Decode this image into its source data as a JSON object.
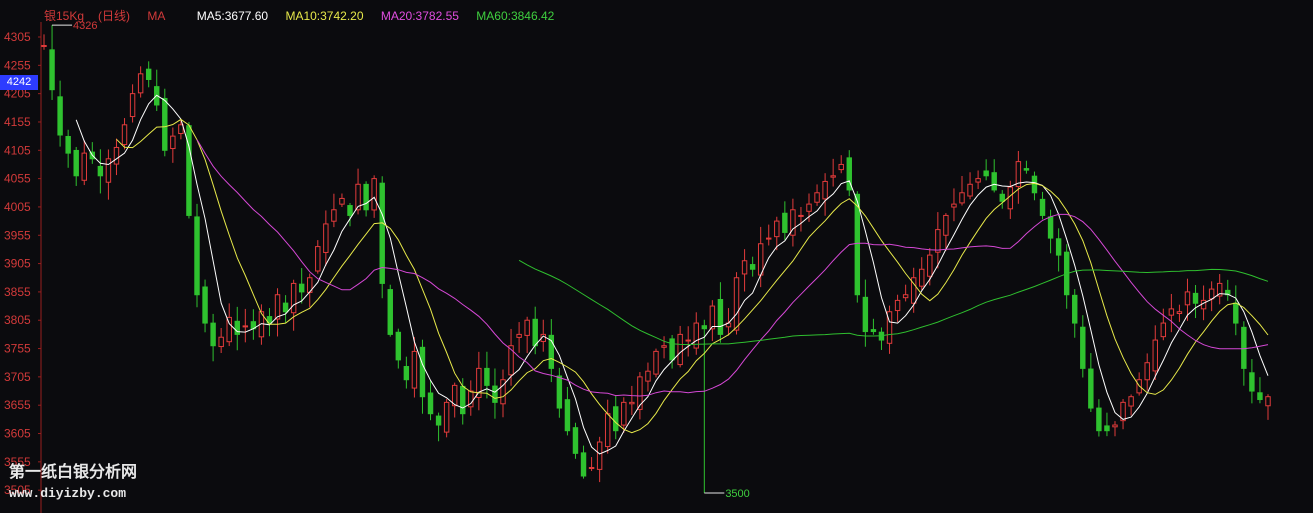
{
  "legend": {
    "title": "银15Kg",
    "period": "(日线)",
    "ma_label": "MA",
    "ma5": "MA5:3677.60",
    "ma10": "MA10:3742.20",
    "ma20": "MA20:3782.55",
    "ma60": "MA60:3846.42"
  },
  "current_price_tag": "4242",
  "watermark": {
    "line1": "第一纸白银分析网",
    "line2": "www.diyizby.com"
  },
  "colors": {
    "up": "#e23b3b",
    "down": "#2fc22f",
    "ma5": "#ffffff",
    "ma10": "#e7e94a",
    "ma20": "#d548d5",
    "ma60": "#2fbf2f",
    "axis_text": "#d23a3a",
    "background": "#0b0b0e"
  },
  "chart_data": {
    "type": "candlestick",
    "y_axis_ticks": [
      4305,
      4255,
      4205,
      4155,
      4105,
      4055,
      4005,
      3955,
      3905,
      3855,
      3805,
      3755,
      3705,
      3655,
      3605,
      3555,
      3505
    ],
    "ylim": [
      3485,
      4345
    ],
    "annotations": [
      {
        "label": "4326",
        "value": 4326,
        "index": 1
      },
      {
        "label": "3500",
        "value": 3500,
        "index": 82
      }
    ],
    "closes": [
      4290,
      4212,
      4132,
      4100,
      4060,
      4100,
      4090,
      4060,
      4090,
      4110,
      4150,
      4205,
      4240,
      4230,
      4185,
      4105,
      4130,
      4150,
      3990,
      3850,
      3800,
      3760,
      3775,
      3810,
      3780,
      3795,
      3790,
      3820,
      3800,
      3850,
      3820,
      3870,
      3855,
      3880,
      3935,
      3975,
      4000,
      4020,
      3990,
      4045,
      4000,
      4055,
      3870,
      3780,
      3735,
      3700,
      3750,
      3670,
      3640,
      3620,
      3660,
      3690,
      3640,
      3680,
      3720,
      3690,
      3660,
      3700,
      3760,
      3780,
      3805,
      3760,
      3780,
      3720,
      3650,
      3610,
      3570,
      3530,
      3545,
      3590,
      3640,
      3610,
      3660,
      3660,
      3705,
      3715,
      3750,
      3760,
      3735,
      3780,
      3770,
      3800,
      3790,
      3830,
      3780,
      3800,
      3880,
      3910,
      3895,
      3940,
      3950,
      3980,
      3960,
      4000,
      3990,
      4010,
      4030,
      4050,
      4060,
      4080,
      4035,
      3850,
      3785,
      3785,
      3770,
      3820,
      3840,
      3850,
      3880,
      3895,
      3920,
      3965,
      3990,
      4010,
      4030,
      4045,
      4055,
      4060,
      4035,
      4015,
      4040,
      4085,
      4070,
      4030,
      3990,
      3950,
      3920,
      3850,
      3800,
      3720,
      3650,
      3610,
      3610,
      3620,
      3660,
      3670,
      3700,
      3730,
      3770,
      3800,
      3825,
      3820,
      3855,
      3835,
      3840,
      3860,
      3870,
      3850,
      3800,
      3720,
      3680,
      3665,
      3670
    ],
    "ma_series": [
      {
        "name": "MA5",
        "current": 3677.6
      },
      {
        "name": "MA10",
        "current": 3742.2
      },
      {
        "name": "MA20",
        "current": 3782.55
      },
      {
        "name": "MA60",
        "current": 3846.42
      }
    ]
  }
}
